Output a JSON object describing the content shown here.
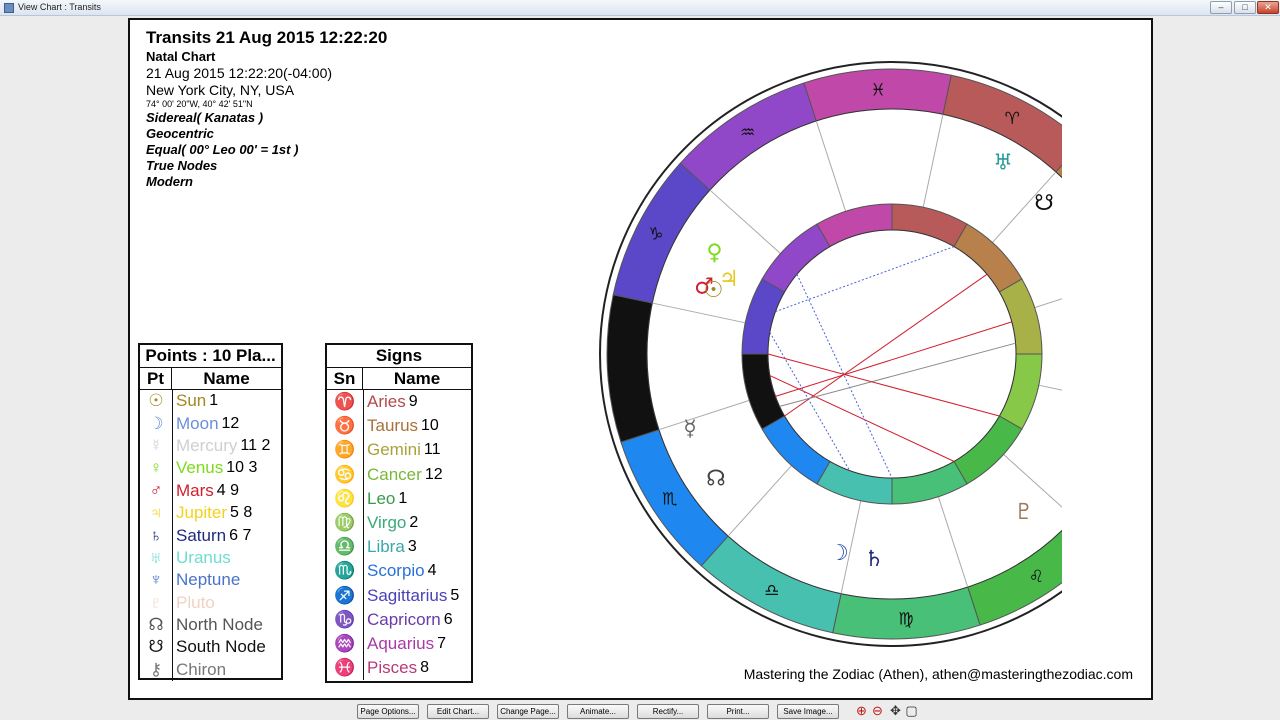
{
  "window": {
    "title": "View Chart : Transits",
    "controls": [
      "–",
      "□",
      "✕"
    ]
  },
  "header": {
    "title": "Transits 21 Aug 2015 12:22:20",
    "subtitle": "Natal Chart",
    "datetime": "21 Aug 2015 12:22:20(-04:00)",
    "place": "New York City, NY, USA",
    "coords": "74° 00' 20\"W, 40° 42' 51\"N",
    "settings": [
      "Sidereal( Kanatas )",
      "Geocentric",
      "Equal( 00° Leo 00' = 1st )",
      "True Nodes",
      "Modern"
    ]
  },
  "points_table": {
    "caption": "Points : 10 Pla...",
    "col_symbol": "Pt",
    "col_name": "Name",
    "rows": [
      {
        "symbol": "☉",
        "name": "Sun",
        "nums": "1",
        "color": "#a0891f"
      },
      {
        "symbol": "☽",
        "name": "Moon",
        "nums": "12",
        "color": "#6b8fd6"
      },
      {
        "symbol": "☿",
        "name": "Mercury",
        "nums": "11 2",
        "color": "#cfcfcf"
      },
      {
        "symbol": "♀",
        "name": "Venus",
        "nums": "10 3",
        "color": "#7cdc1c"
      },
      {
        "symbol": "♂",
        "name": "Mars",
        "nums": "4 9",
        "color": "#d21e2d"
      },
      {
        "symbol": "♃",
        "name": "Jupiter",
        "nums": "5 8",
        "color": "#f2d21c"
      },
      {
        "symbol": "♄",
        "name": "Saturn",
        "nums": "6 7",
        "color": "#1e2a7a"
      },
      {
        "symbol": "♅",
        "name": "Uranus",
        "nums": "",
        "color": "#6fdcd0"
      },
      {
        "symbol": "♆",
        "name": "Neptune",
        "nums": "",
        "color": "#4a72c8"
      },
      {
        "symbol": "♇",
        "name": "Pluto",
        "nums": "",
        "color": "#f0d2c2"
      },
      {
        "symbol": "☊",
        "name": "North Node",
        "nums": "",
        "color": "#555555"
      },
      {
        "symbol": "☋",
        "name": "South Node",
        "nums": "",
        "color": "#111111"
      },
      {
        "symbol": "⚷",
        "name": "Chiron",
        "nums": "",
        "color": "#777777"
      }
    ]
  },
  "signs_table": {
    "caption": "Signs",
    "col_symbol": "Sn",
    "col_name": "Name",
    "rows": [
      {
        "symbol": "♈",
        "name": "Aries",
        "nums": "9",
        "color": "#b24a4a"
      },
      {
        "symbol": "♉",
        "name": "Taurus",
        "nums": "10",
        "color": "#a8723a"
      },
      {
        "symbol": "♊",
        "name": "Gemini",
        "nums": "11",
        "color": "#a8a23a"
      },
      {
        "symbol": "♋",
        "name": "Cancer",
        "nums": "12",
        "color": "#78b83a"
      },
      {
        "symbol": "♌",
        "name": "Leo",
        "nums": "1",
        "color": "#3a9a4a"
      },
      {
        "symbol": "♍",
        "name": "Virgo",
        "nums": "2",
        "color": "#3aa87a"
      },
      {
        "symbol": "♎",
        "name": "Libra",
        "nums": "3",
        "color": "#3aa8a8"
      },
      {
        "symbol": "♏",
        "name": "Scorpio",
        "nums": "4",
        "color": "#2a72d8"
      },
      {
        "symbol": "♐",
        "name": "Sagittarius",
        "nums": "5",
        "color": "#4a42b8"
      },
      {
        "symbol": "♑",
        "name": "Capricorn",
        "nums": "6",
        "color": "#6a3aa8"
      },
      {
        "symbol": "♒",
        "name": "Aquarius",
        "nums": "7",
        "color": "#a83aa8"
      },
      {
        "symbol": "♓",
        "name": "Pisces",
        "nums": "8",
        "color": "#b83a7a"
      }
    ]
  },
  "credit": "Mastering the Zodiac (Athen), athen@masteringthezodiac.com",
  "wheel": {
    "outer_signs": [
      {
        "glyph": "♈",
        "color": "#b85a5a"
      },
      {
        "glyph": "♉",
        "color": "#b8804a"
      },
      {
        "glyph": "♊",
        "color": "#a8b048"
      },
      {
        "glyph": "♋",
        "color": "#88c848"
      },
      {
        "glyph": "♌",
        "color": "#48b848"
      },
      {
        "glyph": "♍",
        "color": "#48c078"
      },
      {
        "glyph": "♎",
        "color": "#48c0b0"
      },
      {
        "glyph": "♏",
        "color": "#1e88f0"
      },
      {
        "glyph": "♐",
        "color": "#111111"
      },
      {
        "glyph": "♑",
        "color": "#5a48c8"
      },
      {
        "glyph": "♒",
        "color": "#9048c8"
      },
      {
        "glyph": "♓",
        "color": "#c048a8"
      }
    ],
    "transit_planets": [
      {
        "glyph": "♂",
        "color": "#d21e2d"
      },
      {
        "glyph": "♀",
        "color": "#7cdc1c"
      },
      {
        "glyph": "☉",
        "color": "#a0891f"
      },
      {
        "glyph": "♃",
        "color": "#e8c81c"
      },
      {
        "glyph": "☿",
        "color": "#666666"
      },
      {
        "glyph": "☊",
        "color": "#444444"
      },
      {
        "glyph": "☽",
        "color": "#2a4aa8"
      },
      {
        "glyph": "♄",
        "color": "#1e2a7a"
      },
      {
        "glyph": "♇",
        "color": "#a07858"
      },
      {
        "glyph": "♆",
        "color": "#3a52a8"
      },
      {
        "glyph": "⚷",
        "color": "#444444"
      },
      {
        "glyph": "☋",
        "color": "#111111"
      },
      {
        "glyph": "♅",
        "color": "#2a9a9a"
      }
    ],
    "retro_label": "℞"
  },
  "toolbar": {
    "buttons": [
      "Page Options...",
      "Edit Chart...",
      "Change Page...",
      "Animate...",
      "Rectify...",
      "Print...",
      "Save Image..."
    ],
    "zoom_icons": [
      "⊕",
      "⊖",
      "✥",
      "▢"
    ]
  }
}
